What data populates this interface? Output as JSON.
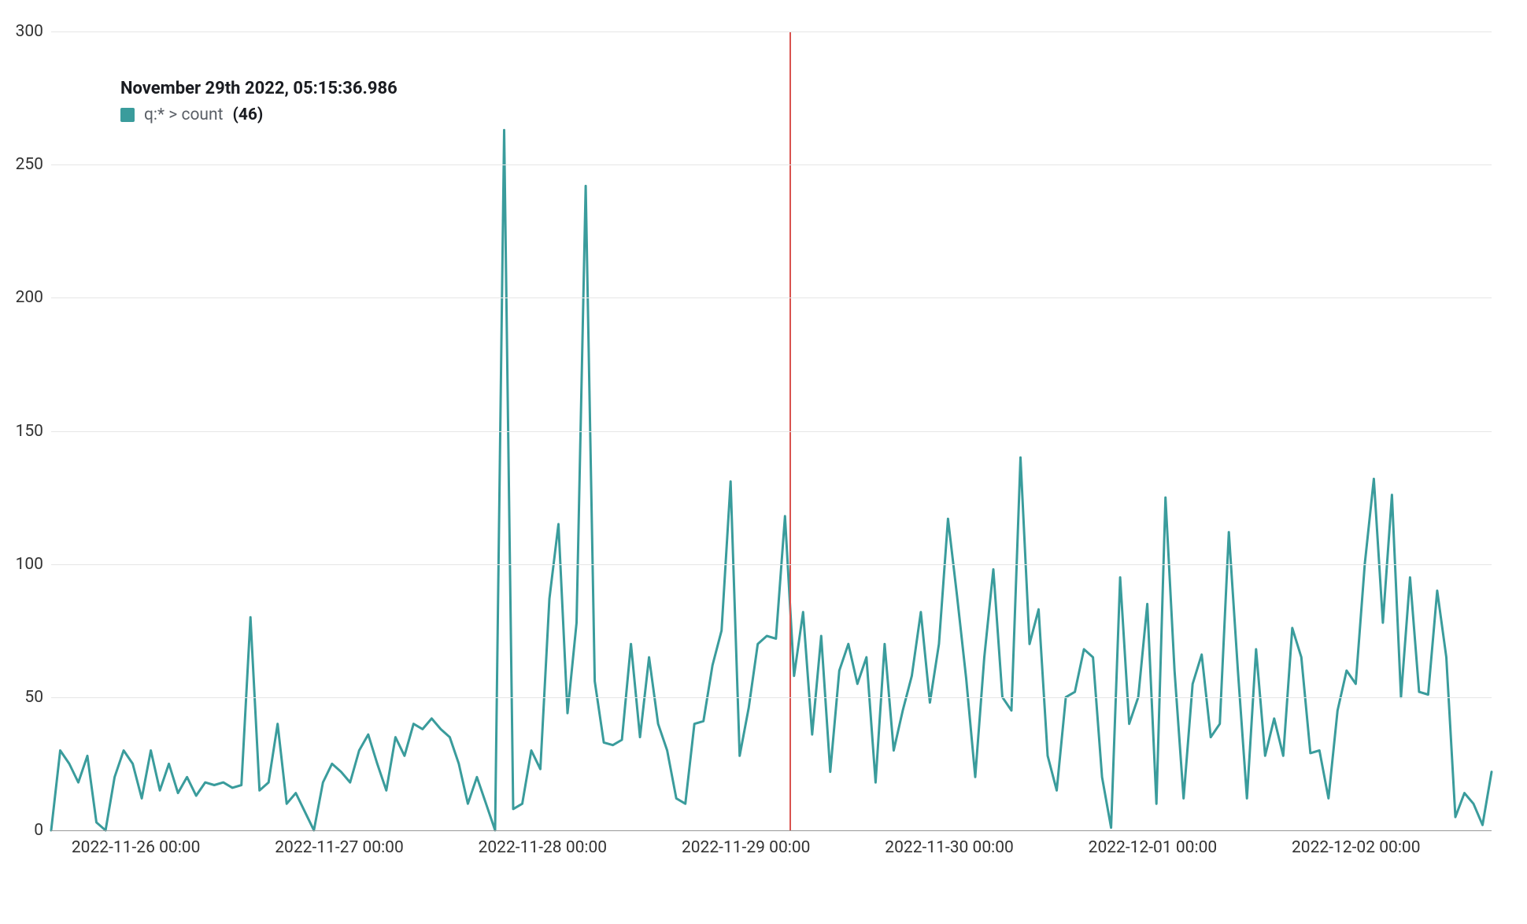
{
  "tooltip": {
    "timestamp": "November 29th 2022, 05:15:36.986",
    "series_label": "q:* > count",
    "value_label": "(46)"
  },
  "colors": {
    "series": "#3a9c9c",
    "hover_line": "#d9534f",
    "grid": "#e6e6e6",
    "axis": "#999999"
  },
  "chart_data": {
    "type": "line",
    "xlabel": "",
    "ylabel": "",
    "ylim": [
      0,
      300
    ],
    "y_ticks": [
      0,
      50,
      100,
      150,
      200,
      250,
      300
    ],
    "x_tick_labels": [
      "2022-11-26 00:00",
      "2022-11-27 00:00",
      "2022-11-28 00:00",
      "2022-11-29 00:00",
      "2022-11-30 00:00",
      "2022-12-01 00:00",
      "2022-12-02 00:00"
    ],
    "x_range_hours": [
      -10,
      160
    ],
    "x_tick_hours": [
      0,
      24,
      48,
      72,
      96,
      120,
      144
    ],
    "hover_x_hour": 77.25,
    "hover_value": 46,
    "series": [
      {
        "name": "q:* > count",
        "color": "#3a9c9c",
        "values": [
          0,
          30,
          25,
          18,
          28,
          3,
          0,
          20,
          30,
          25,
          12,
          30,
          15,
          25,
          14,
          20,
          13,
          18,
          17,
          18,
          16,
          17,
          80,
          15,
          18,
          40,
          10,
          14,
          7,
          0,
          18,
          25,
          22,
          18,
          30,
          36,
          25,
          15,
          35,
          28,
          40,
          38,
          42,
          38,
          35,
          25,
          10,
          20,
          10,
          0,
          263,
          8,
          10,
          30,
          23,
          87,
          115,
          44,
          78,
          242,
          56,
          33,
          32,
          34,
          70,
          35,
          65,
          40,
          30,
          12,
          10,
          40,
          41,
          62,
          75,
          131,
          28,
          46,
          70,
          73,
          72,
          118,
          58,
          82,
          36,
          73,
          22,
          60,
          70,
          55,
          65,
          18,
          70,
          30,
          45,
          58,
          82,
          48,
          70,
          117,
          88,
          57,
          20,
          65,
          98,
          50,
          45,
          140,
          70,
          83,
          28,
          15,
          50,
          52,
          68,
          65,
          20,
          1,
          95,
          40,
          50,
          85,
          10,
          125,
          60,
          12,
          55,
          66,
          35,
          40,
          112,
          60,
          12,
          68,
          28,
          42,
          28,
          76,
          65,
          29,
          30,
          12,
          45,
          60,
          55,
          100,
          132,
          78,
          126,
          50,
          95,
          52,
          51,
          90,
          65,
          5,
          14,
          10,
          2,
          22
        ]
      }
    ]
  }
}
